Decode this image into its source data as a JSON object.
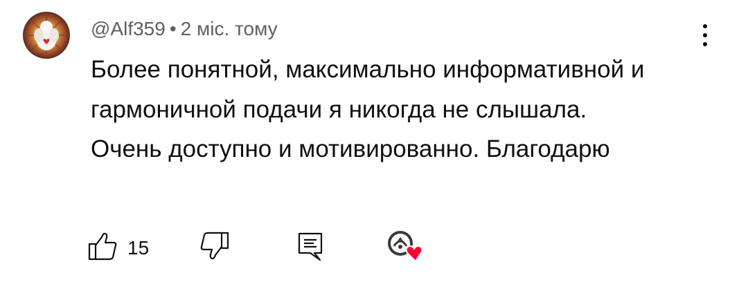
{
  "comment": {
    "author": "@Alf359",
    "separator": "•",
    "timestamp": "2 міс. тому",
    "text": "Более понятной, максимально информативной и гармоничной подачи я никогда не слышала. Очень доступно и мотивированно. Благодарю",
    "like_count": "15"
  },
  "icons": {
    "menu": "kebab-vertical-icon",
    "like": "thumb-up-icon",
    "dislike": "thumb-down-icon",
    "reply": "reply-comment-icon",
    "creator_heart": "creator-heart-icon"
  },
  "colors": {
    "text": "#0f0f0f",
    "meta": "#606060",
    "heart": "#ff0033"
  }
}
